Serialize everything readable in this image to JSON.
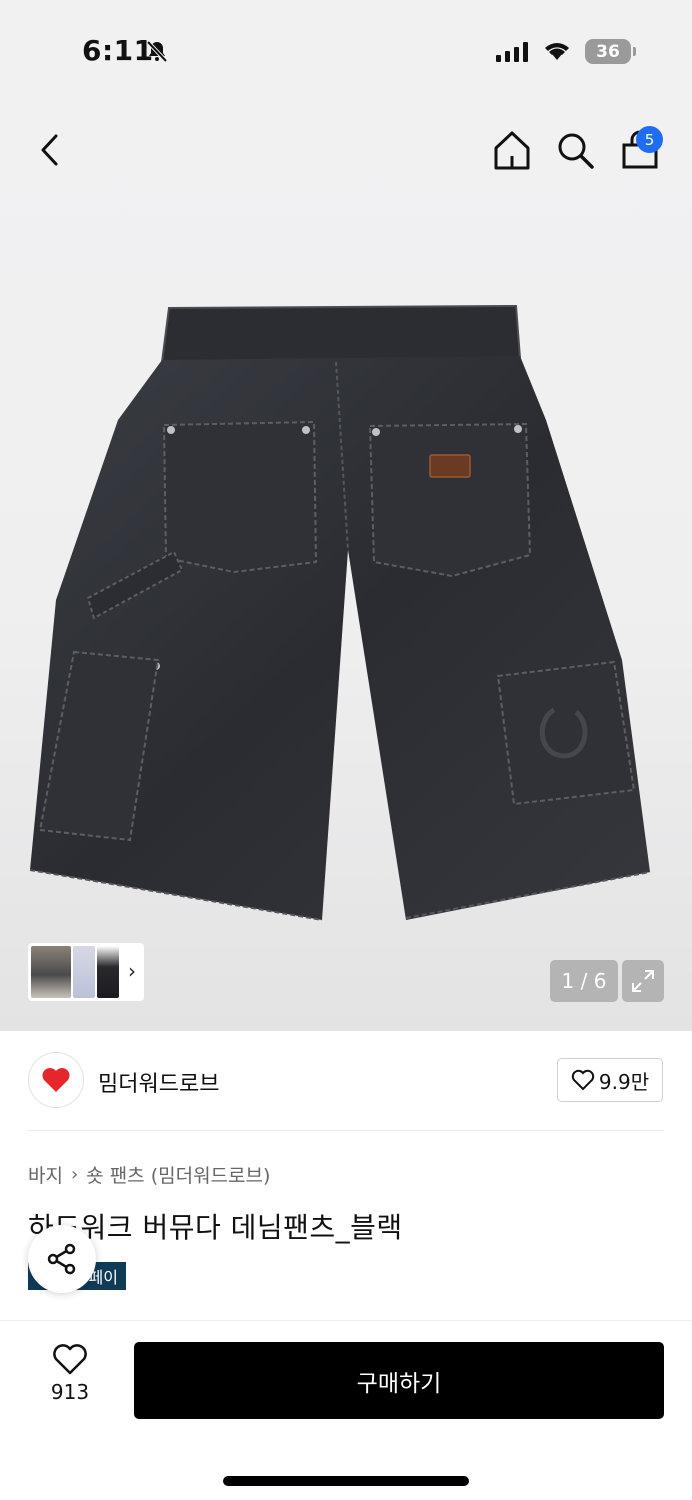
{
  "status_bar": {
    "time": "6:11",
    "battery": "36"
  },
  "header": {
    "cart_count": "5"
  },
  "gallery": {
    "counter": "1 / 6"
  },
  "brand": {
    "name": "밈더워드로브",
    "likes": "9.9만"
  },
  "breadcrumb": {
    "category": "바지",
    "subcategory": "숏 팬츠 (밈더워드로브)"
  },
  "product": {
    "title": "하드워크 버뮤다 데님팬츠_블랙",
    "badge": "페이"
  },
  "bottom_bar": {
    "like_count": "913",
    "buy_label": "구매하기"
  },
  "colors": {
    "accent_blue": "#1f6df2",
    "buy_button": "#000000",
    "pay_badge": "#0f3b57"
  }
}
